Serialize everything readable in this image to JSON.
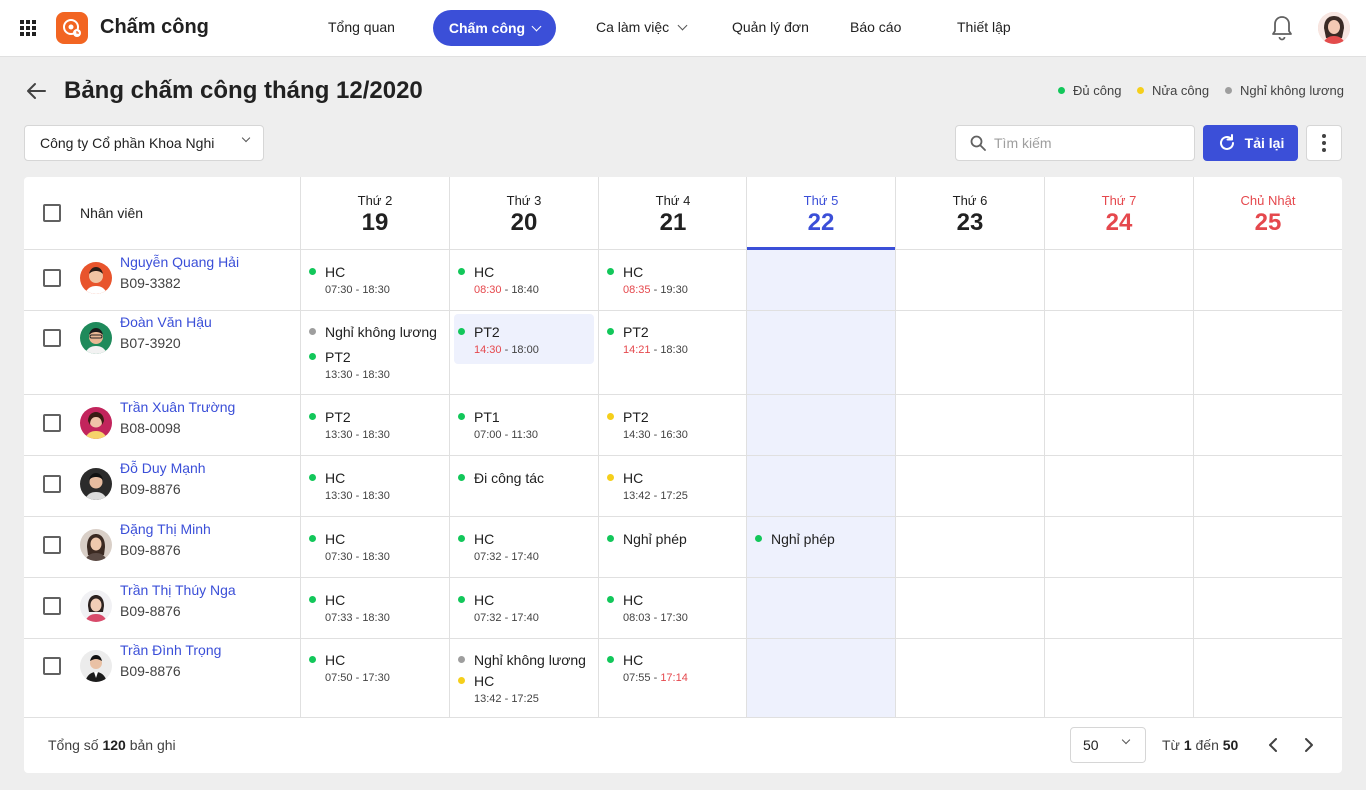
{
  "app": {
    "title": "Chấm công"
  },
  "nav": {
    "items": [
      "Tổng quan",
      "Chấm công",
      "Ca làm việc",
      "Quản lý đơn",
      "Báo cáo",
      "Thiết lập"
    ],
    "active": "Chấm công"
  },
  "colors": {
    "accent": "#3b4fd8",
    "full": "#12c75a",
    "half": "#f5cf1b",
    "unpaid": "#9e9e9e",
    "late": "#e5484d",
    "logo": "#f26522"
  },
  "page": {
    "title": "Bảng chấm công tháng 12/2020"
  },
  "legend": {
    "full": "Đủ công",
    "half": "Nửa công",
    "unpaid": "Nghỉ không lương"
  },
  "filter": {
    "company": "Công ty Cổ phần Khoa Nghi",
    "search_placeholder": "Tìm kiếm",
    "reload_label": "Tải lại"
  },
  "table": {
    "employee_header": "Nhân viên",
    "days": [
      {
        "name": "Thứ 2",
        "num": "19"
      },
      {
        "name": "Thứ 3",
        "num": "20"
      },
      {
        "name": "Thứ 4",
        "num": "21"
      },
      {
        "name": "Thứ 5",
        "num": "22"
      },
      {
        "name": "Thứ 6",
        "num": "23"
      },
      {
        "name": "Thứ 7",
        "num": "24"
      },
      {
        "name": "Chủ Nhật",
        "num": "25"
      }
    ],
    "rows": [
      {
        "name": "Nguyễn Quang Hải",
        "code": "B09-3382",
        "cells": [
          {
            "label": "HC",
            "in": "07:30",
            "out": "18:30"
          },
          {
            "label": "HC",
            "in": "08:30",
            "out": "18:40"
          },
          {
            "label": "HC",
            "in": "08:35",
            "out": "19:30"
          }
        ]
      },
      {
        "name": "Đoàn Văn Hậu",
        "code": "B07-3920",
        "cells": [
          {
            "label": "Nghỉ không lương",
            "label2": "PT2",
            "in2": "13:30",
            "out2": "18:30"
          },
          {
            "label": "PT2",
            "in": "14:30",
            "out": "18:00"
          },
          {
            "label": "PT2",
            "in": "14:21",
            "out": "18:30"
          }
        ]
      },
      {
        "name": "Trần Xuân Trường",
        "code": "B08-0098",
        "cells": [
          {
            "label": "PT2",
            "in": "13:30",
            "out": "18:30"
          },
          {
            "label": "PT1",
            "in": "07:00",
            "out": "11:30"
          },
          {
            "label": "PT2",
            "in": "14:30",
            "out": "16:30"
          }
        ]
      },
      {
        "name": "Đỗ Duy Mạnh",
        "code": "B09-8876",
        "cells": [
          {
            "label": "HC",
            "in": "13:30",
            "out": "18:30"
          },
          {
            "label": "Đi công tác"
          },
          {
            "label": "HC",
            "in": "13:42",
            "out": "17:25"
          }
        ]
      },
      {
        "name": "Đặng Thị Minh",
        "code": "B09-8876",
        "cells": [
          {
            "label": "HC",
            "in": "07:30",
            "out": "18:30"
          },
          {
            "label": "HC",
            "in": "07:32",
            "out": "17:40"
          },
          {
            "label": "Nghỉ phép"
          },
          {
            "label": "Nghỉ phép"
          }
        ]
      },
      {
        "name": "Trần Thị Thúy Nga",
        "code": "B09-8876",
        "cells": [
          {
            "label": "HC",
            "in": "07:33",
            "out": "18:30"
          },
          {
            "label": "HC",
            "in": "07:32",
            "out": "17:40"
          },
          {
            "label": "HC",
            "in": "08:03",
            "out": "17:30"
          }
        ]
      },
      {
        "name": "Trần Đình Trọng",
        "code": "B09-8876",
        "cells": [
          {
            "label": "HC",
            "in": "07:50",
            "out": "17:30"
          },
          {
            "label": "Nghỉ không lương",
            "label2": "HC",
            "in2": "13:42",
            "out2": "17:25"
          },
          {
            "label": "HC",
            "in": "07:55",
            "out": "17:14"
          }
        ]
      }
    ]
  },
  "footer": {
    "total_prefix": "Tổng số",
    "total": "120",
    "total_suffix": "bản ghi",
    "page_size": "50",
    "range_from_label": "Từ",
    "range_from": "1",
    "range_to_label": "đến",
    "range_to": "50"
  }
}
